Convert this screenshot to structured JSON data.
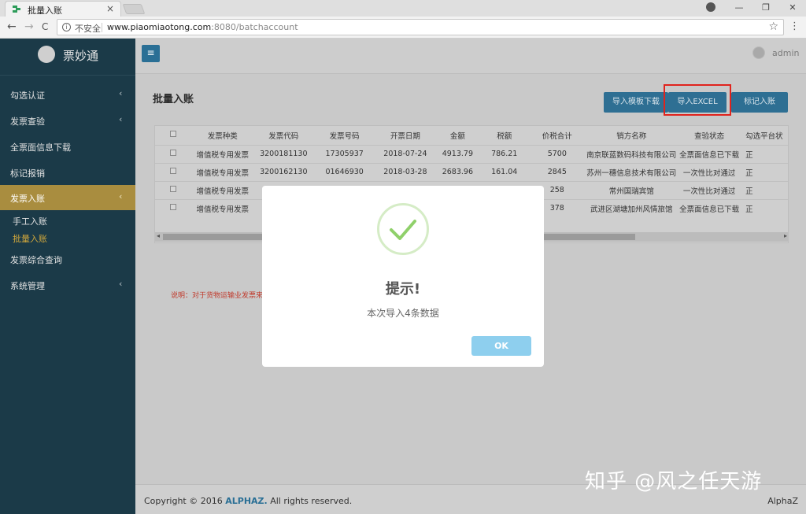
{
  "browser": {
    "tab_title": "批量入账",
    "tab_close": "×",
    "insecure_label": "不安全",
    "url_host": "www.piaomiaotong.com",
    "url_rest": ":8080/batchaccount",
    "back": "←",
    "forward": "→",
    "reload": "C",
    "star": "☆",
    "menu": "⋮",
    "win_min": "—",
    "win_restore": "❐",
    "win_close": "✕"
  },
  "sidebar": {
    "brand": "票妙通",
    "items": [
      {
        "label": "勾选认证",
        "chevron": "‹"
      },
      {
        "label": "发票查验",
        "chevron": "‹"
      },
      {
        "label": "全票面信息下载",
        "chevron": ""
      },
      {
        "label": "标记报销",
        "chevron": ""
      },
      {
        "label": "发票入账",
        "chevron": "‹"
      },
      {
        "label": "发票综合查询",
        "chevron": ""
      },
      {
        "label": "系统管理",
        "chevron": "‹"
      }
    ],
    "sub_items": [
      "手工入账",
      "批量入账"
    ]
  },
  "header": {
    "menu_icon": "≡",
    "username": "admin"
  },
  "main": {
    "title": "批量入账",
    "buttons": [
      "导入模板下载",
      "导入EXCEL",
      "标记入账"
    ],
    "note": "说明：对于货物运输业发票来"
  },
  "table": {
    "columns": [
      "发票种类",
      "发票代码",
      "发票号码",
      "开票日期",
      "金额",
      "税额",
      "价税合计",
      "销方名称",
      "查验状态",
      "勾选平台状"
    ],
    "rows": [
      [
        "增值税专用发票",
        "3200181130",
        "17305937",
        "2018-07-24",
        "4913.79",
        "786.21",
        "5700",
        "南京联蓝数码科技有限公司",
        "全票面信息已下载",
        "正"
      ],
      [
        "增值税专用发票",
        "3200162130",
        "01646930",
        "2018-03-28",
        "2683.96",
        "161.04",
        "2845",
        "苏州一穗信息技术有限公司",
        "一次性比对通过",
        "正"
      ],
      [
        "增值税专用发票",
        "",
        "",
        "",
        "",
        "",
        "258",
        "常州国瑞宾馆",
        "一次性比对通过",
        "正"
      ],
      [
        "增值税专用发票",
        "",
        "",
        "",
        "",
        "",
        "378",
        "武进区湖塘加州风情旅馆",
        "全票面信息已下载",
        "正"
      ]
    ],
    "scroll_left": "◂",
    "scroll_right": "▸"
  },
  "footer": {
    "copyright_prefix": "Copyright © 2016 ",
    "copyright_brand": "ALPHAZ.",
    "copyright_suffix": " All rights reserved.",
    "right": "AlphaZ"
  },
  "modal": {
    "title": "提示!",
    "message": "本次导入4条数据",
    "ok": "OK"
  },
  "watermark": "知乎 @风之任天游"
}
